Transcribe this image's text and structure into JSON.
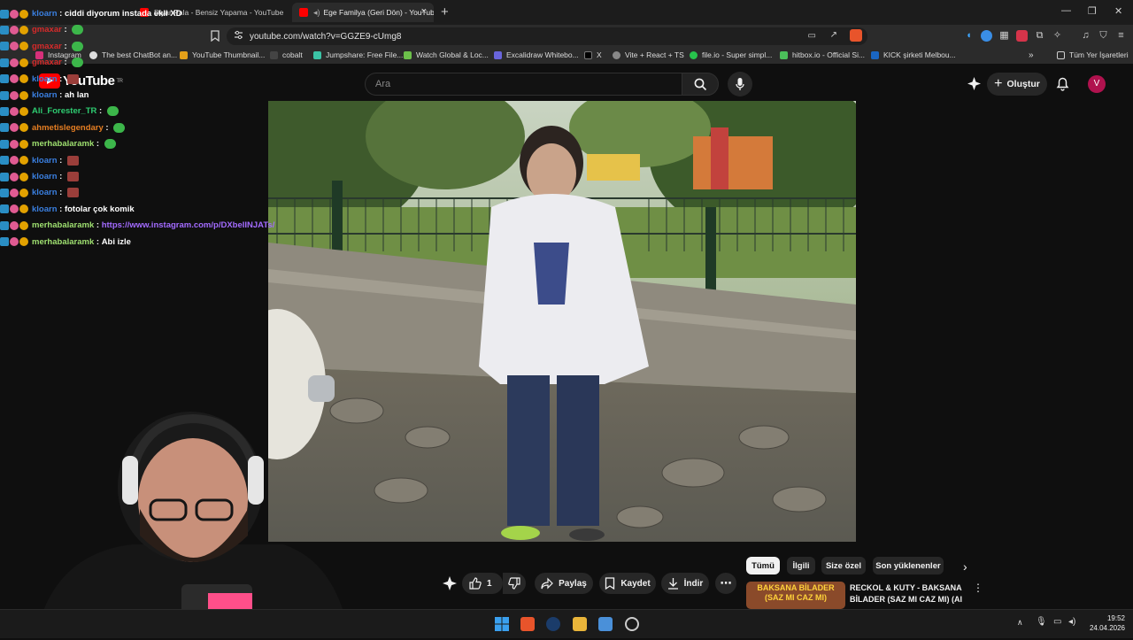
{
  "browser": {
    "tabs": [
      {
        "label": "Diyar Pala - Bensiz Yapama - YouTube",
        "active": false
      },
      {
        "label": "Ege Familya (Geri Dön) - YouTube",
        "active": true
      }
    ],
    "url": "youtube.com/watch?v=GGZE9-cUmg8",
    "bookmarks": [
      "Instagram",
      "The best ChatBot an...",
      "YouTube Thumbnail...",
      "cobalt",
      "Jumpshare: Free File...",
      "Watch Global & Loc...",
      "Excalidraw Whitebo...",
      "X",
      "Vite + React + TS",
      "file.io - Super simpl...",
      "hitbox.io - Official Si...",
      "KICK şirketi Melbou..."
    ],
    "bookmarks_all": "Tüm Yer İşaretleri"
  },
  "youtube": {
    "logo": "YouTube",
    "logo_region": "TR",
    "search_placeholder": "Ara",
    "create_label": "Oluştur",
    "avatar_letter": "V",
    "actions": {
      "like_count": "1",
      "share": "Paylaş",
      "save": "Kaydet",
      "download": "İndir"
    },
    "chips": [
      "Tümü",
      "İlgili",
      "Size özel",
      "Son yüklenenler"
    ],
    "related_video": {
      "thumb_text": "BAKSANA BİLADER (SAZ MI CAZ MI)",
      "title": "RECKOL & KUTY - BAKSANA BİLADER (SAZ MI CAZ MI) (AI ..."
    }
  },
  "chat": [
    {
      "user": "kloarn",
      "color": "#3a7fe0",
      "msg": "ciddi diyorum instada ekli XD",
      "emote": ""
    },
    {
      "user": "gmaxar",
      "color": "#d62a2a",
      "msg": "",
      "emote": "green"
    },
    {
      "user": "gmaxar",
      "color": "#d62a2a",
      "msg": "",
      "emote": "green"
    },
    {
      "user": "gmaxar",
      "color": "#d62a2a",
      "msg": "",
      "emote": "green"
    },
    {
      "user": "kloarn",
      "color": "#3a7fe0",
      "msg": "",
      "emote": "red"
    },
    {
      "user": "kloarn",
      "color": "#3a7fe0",
      "msg": "ah lan",
      "emote": ""
    },
    {
      "user": "Ali_Forester_TR",
      "color": "#2ecc71",
      "msg": "",
      "emote": "green"
    },
    {
      "user": "ahmetislegendary",
      "color": "#e67e22",
      "msg": "",
      "emote": "green"
    },
    {
      "user": "merhabalaramk",
      "color": "#9fe070",
      "msg": "",
      "emote": "green"
    },
    {
      "user": "kloarn",
      "color": "#3a7fe0",
      "msg": "",
      "emote": "red"
    },
    {
      "user": "kloarn",
      "color": "#3a7fe0",
      "msg": "",
      "emote": "red"
    },
    {
      "user": "kloarn",
      "color": "#3a7fe0",
      "msg": "",
      "emote": "red"
    },
    {
      "user": "kloarn",
      "color": "#3a7fe0",
      "msg": "fotolar çok komik",
      "emote": ""
    },
    {
      "user": "merhabalaramk",
      "color": "#9fe070",
      "msg": "",
      "link": "https://www.instagram.com/p/DXbeIINJATs/",
      "emote": ""
    },
    {
      "user": "merhabalaramk",
      "color": "#9fe070",
      "msg": "Abi izle",
      "emote": ""
    }
  ],
  "taskbar": {
    "time": "19:52",
    "date": "24.04.2026"
  },
  "colors": {
    "bg": "#0f0f0f",
    "accent": "#ff0000",
    "chip_active": "#f1f1f1"
  }
}
